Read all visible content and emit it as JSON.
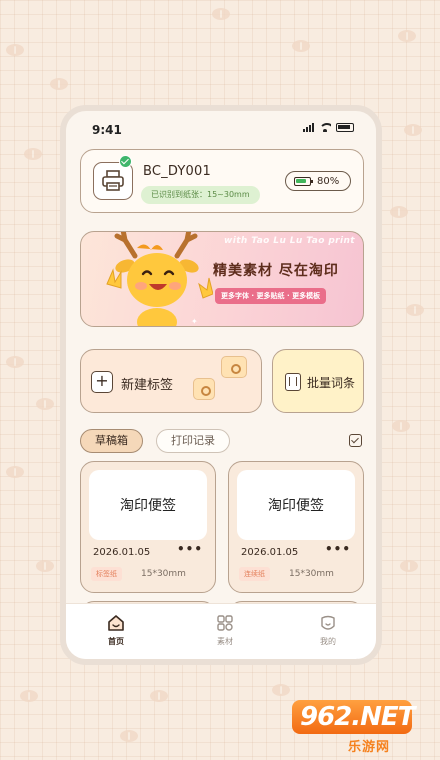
{
  "status_bar": {
    "time": "9:41"
  },
  "device": {
    "name": "BC_DY001",
    "paper_status": "已识别到纸张：15~30mm",
    "battery": "80%"
  },
  "banner": {
    "english": "with Tao Lu Lu Tao print",
    "title": "精美素材 尽在淘印",
    "subtitle": "更多字体 · 更多贴纸 · 更多模板"
  },
  "actions": {
    "new_label": "新建标签",
    "batch": "批量词条"
  },
  "tabs": {
    "drafts": "草稿箱",
    "history": "打印记录"
  },
  "drafts": [
    {
      "preview": "淘印便签",
      "date": "2026.01.05",
      "more": "•••",
      "tag": "标签纸",
      "size": "15*30mm"
    },
    {
      "preview": "淘印便签",
      "date": "2026.01.05",
      "more": "•••",
      "tag": "连续纸",
      "size": "15*30mm"
    }
  ],
  "tabbar": {
    "home": "首页",
    "materials": "素材",
    "mine": "我的"
  },
  "watermark": {
    "logo": "962.NET",
    "text": "乐游网"
  },
  "colors": {
    "accent": "#f5d8b9",
    "border": "#b8a28f",
    "battery_green": "#41b65c",
    "banner_pink": "#ea6e8a"
  }
}
